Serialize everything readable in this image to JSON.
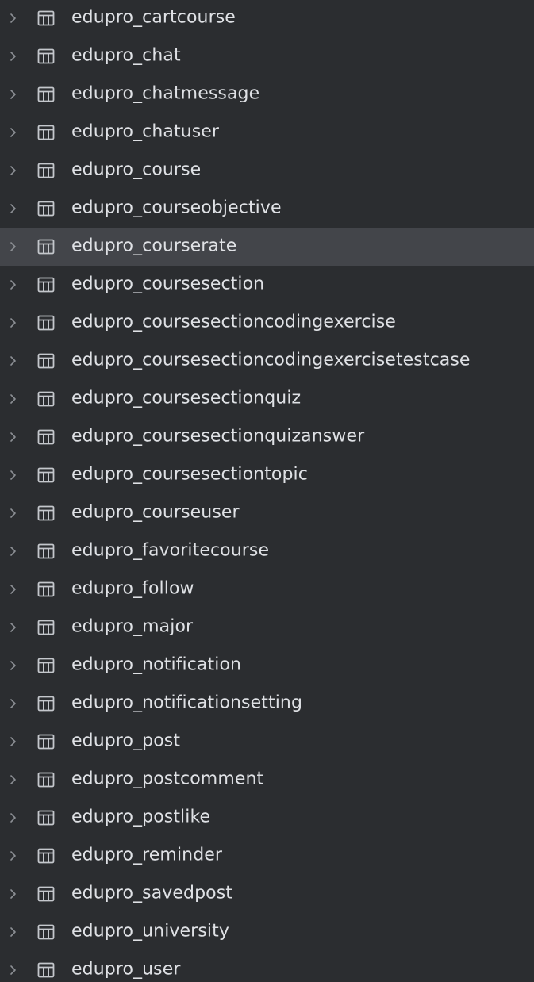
{
  "colors": {
    "background": "#2b2d30",
    "selected_row": "#43454a",
    "text": "#dfe1e5",
    "icon": "#c4c7cc",
    "chevron": "#8c8f94"
  },
  "icons": {
    "expand": "chevron-right-icon",
    "table": "table-icon"
  },
  "tree": {
    "selected_index": 6,
    "items": [
      {
        "label": "edupro_cartcourse"
      },
      {
        "label": "edupro_chat"
      },
      {
        "label": "edupro_chatmessage"
      },
      {
        "label": "edupro_chatuser"
      },
      {
        "label": "edupro_course"
      },
      {
        "label": "edupro_courseobjective"
      },
      {
        "label": "edupro_courserate"
      },
      {
        "label": "edupro_coursesection"
      },
      {
        "label": "edupro_coursesectioncodingexercise"
      },
      {
        "label": "edupro_coursesectioncodingexercisetestcase"
      },
      {
        "label": "edupro_coursesectionquiz"
      },
      {
        "label": "edupro_coursesectionquizanswer"
      },
      {
        "label": "edupro_coursesectiontopic"
      },
      {
        "label": "edupro_courseuser"
      },
      {
        "label": "edupro_favoritecourse"
      },
      {
        "label": "edupro_follow"
      },
      {
        "label": "edupro_major"
      },
      {
        "label": "edupro_notification"
      },
      {
        "label": "edupro_notificationsetting"
      },
      {
        "label": "edupro_post"
      },
      {
        "label": "edupro_postcomment"
      },
      {
        "label": "edupro_postlike"
      },
      {
        "label": "edupro_reminder"
      },
      {
        "label": "edupro_savedpost"
      },
      {
        "label": "edupro_university"
      },
      {
        "label": "edupro_user"
      }
    ]
  }
}
